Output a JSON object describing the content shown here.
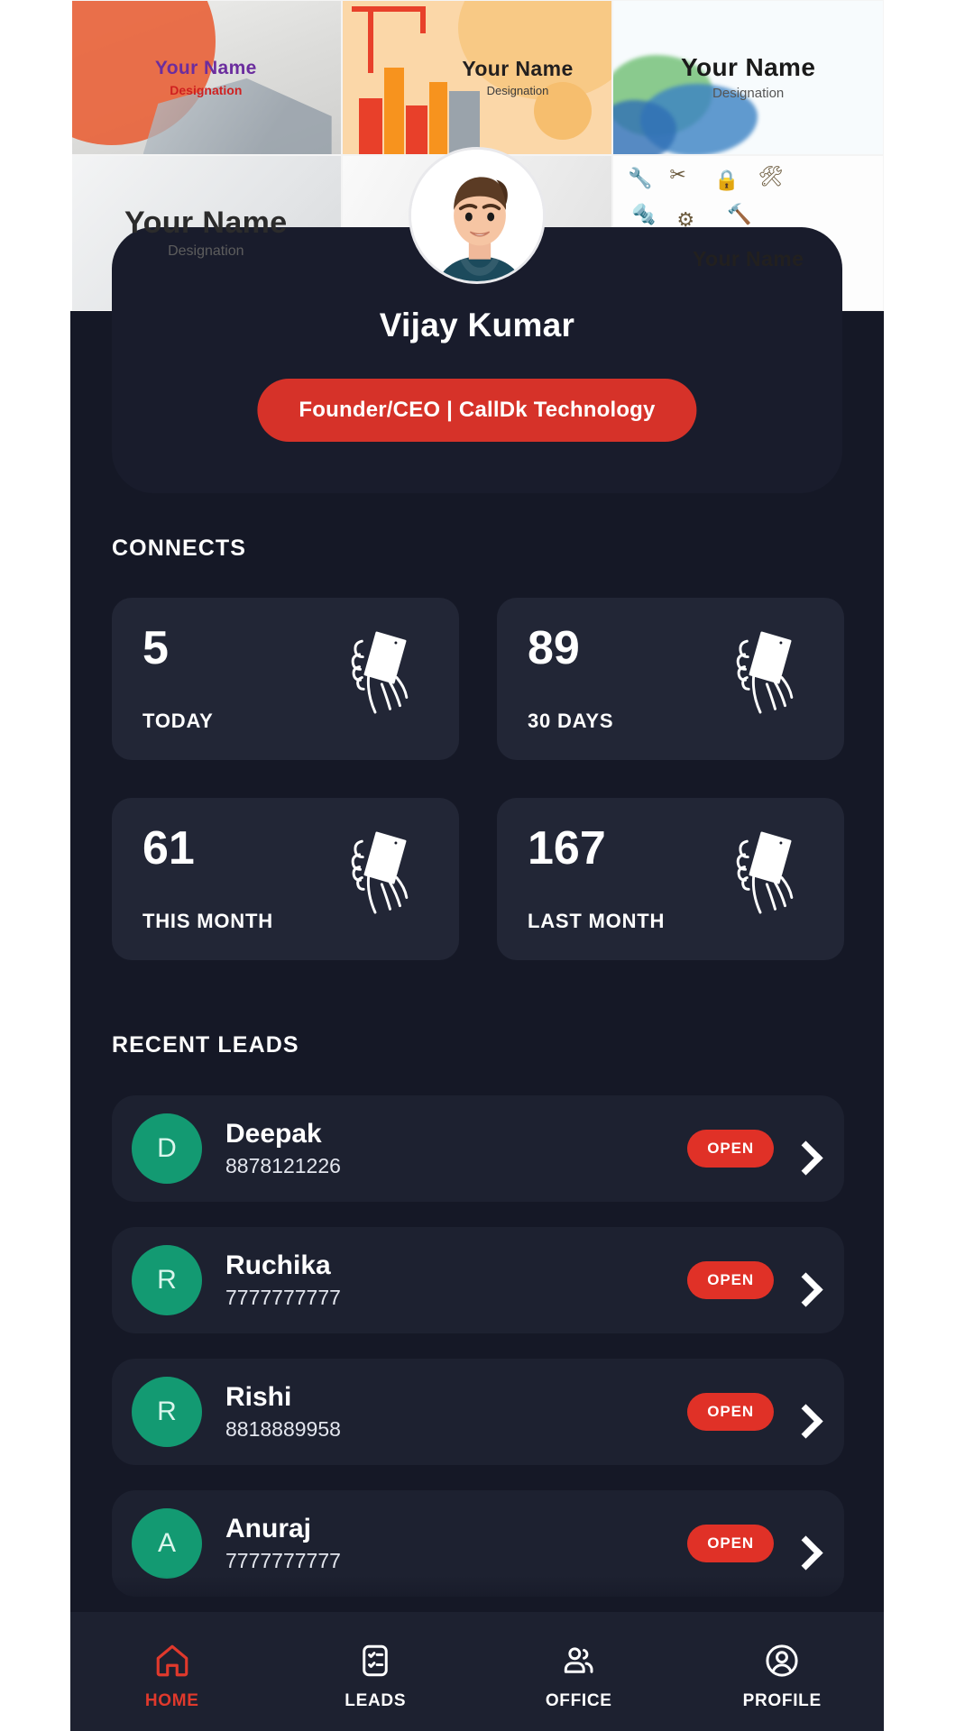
{
  "banner": {
    "cards": [
      {
        "name": "Your Name",
        "designation": "Designation"
      },
      {
        "name": "Your Name",
        "designation": "Designation"
      },
      {
        "name": "Your Name",
        "designation": "Designation"
      },
      {
        "name": "Your Name",
        "designation": "Designation"
      },
      {
        "name": "",
        "designation": ""
      },
      {
        "name": "Your Name",
        "designation": ""
      }
    ]
  },
  "profile": {
    "name": "Vijay Kumar",
    "designation": "Founder/CEO | CallDk Technology",
    "avatar_icon": "user-avatar-illustration",
    "badge_color": "#d63229"
  },
  "connects": {
    "title": "CONNECTS",
    "cards": [
      {
        "value": "5",
        "label": "TODAY",
        "icon": "hand-holding-phone-icon"
      },
      {
        "value": "89",
        "label": "30 DAYS",
        "icon": "hand-holding-phone-icon"
      },
      {
        "value": "61",
        "label": "THIS MONTH",
        "icon": "hand-holding-phone-icon"
      },
      {
        "value": "167",
        "label": "LAST MONTH",
        "icon": "hand-holding-phone-icon"
      }
    ]
  },
  "recent_leads": {
    "title": "RECENT LEADS",
    "status_color": "#e03127",
    "avatar_color": "#139a72",
    "items": [
      {
        "initial": "D",
        "name": "Deepak",
        "phone": "8878121226",
        "status": "OPEN"
      },
      {
        "initial": "R",
        "name": "Ruchika",
        "phone": "7777777777",
        "status": "OPEN"
      },
      {
        "initial": "R",
        "name": "Rishi",
        "phone": "8818889958",
        "status": "OPEN"
      },
      {
        "initial": "A",
        "name": "Anuraj",
        "phone": "7777777777",
        "status": "OPEN"
      }
    ]
  },
  "bottom_nav": {
    "active_color": "#e0392c",
    "items": [
      {
        "label": "HOME",
        "icon": "home-icon",
        "active": true
      },
      {
        "label": "LEADS",
        "icon": "checklist-icon",
        "active": false
      },
      {
        "label": "OFFICE",
        "icon": "people-icon",
        "active": false
      },
      {
        "label": "PROFILE",
        "icon": "user-circle-icon",
        "active": false
      }
    ]
  }
}
